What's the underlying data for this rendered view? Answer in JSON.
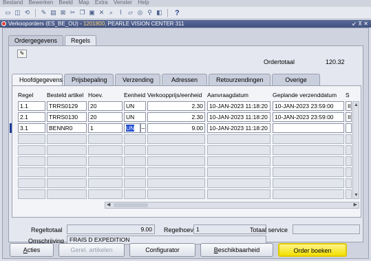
{
  "menubar": [
    "Bestand",
    "Bewerken",
    "Beeld",
    "Map",
    "Extra",
    "Venster",
    "Help"
  ],
  "toolbar": {
    "icons": [
      "folder-open-icon",
      "save-icon",
      "refresh-icon",
      "switch-icon",
      "print-icon",
      "delete-icon",
      "cut-icon",
      "copy-icon",
      "paste-icon",
      "clear-icon",
      "find-icon",
      "attach-icon",
      "folder-icon",
      "translate-icon",
      "zoom-icon",
      "window-icon"
    ],
    "help": "?"
  },
  "window": {
    "title_prefix": "Verkooporders (ES_BE_OU) - ",
    "order_number": "1201800",
    "title_suffix": ", PEARLE VISION CENTER 311",
    "controls": "↙ ⊼ ✕"
  },
  "outer_tabs": [
    "Ordergegevens",
    "Regels"
  ],
  "ordertotaal": {
    "label": "Ordertotaal",
    "value": "120.32"
  },
  "inner_tabs": [
    "Hoofdgegevens",
    "Prijsbepaling",
    "Verzending",
    "Adressen",
    "Retourzendingen",
    "Overige"
  ],
  "columns": [
    "Regel",
    "Besteld artikel",
    "Hoev.",
    "Eenheid",
    "Verkoopprijs/eenheid",
    "Aanvraagdatum",
    "Geplande verzenddatum",
    "S"
  ],
  "rows": [
    {
      "regel": "1.1",
      "artikel": "TRRS0129",
      "hoev": "20",
      "eenheid": "UN",
      "prijs": "2.30",
      "aanvraag": "10-JAN-2023 11:18:20",
      "gepland": "10-JAN-2023 23:59:00",
      "s": "II"
    },
    {
      "regel": "2.1",
      "artikel": "TRRS0130",
      "hoev": "20",
      "eenheid": "UN",
      "prijs": "2.30",
      "aanvraag": "10-JAN-2023 11:18:20",
      "gepland": "10-JAN-2023 23:59:00",
      "s": "II"
    },
    {
      "regel": "3.1",
      "artikel": "BENNR0",
      "hoev": "1",
      "eenheid": "UN",
      "prijs": "9.00",
      "aanvraag": "10-JAN-2023 11:18:20",
      "gepland": "",
      "s": ""
    }
  ],
  "footer_fields": {
    "regeltotaal_label": "Regeltotaal",
    "regeltotaal_value": "9.00",
    "regelhoev_label": "Regelhoev.",
    "regelhoev_value": "1",
    "totaal_service_label": "Totaal service",
    "totaal_service_value": "",
    "omschrijving_label": "Omschrijving",
    "omschrijving_value": "FRAIS D EXPEDITION"
  },
  "buttons": {
    "acties_u": "A",
    "acties_rest": "cties",
    "gerel": "Gerel. artikelen",
    "configurator": "Configurator",
    "beschik_u": "B",
    "beschik_rest": "eschikbaarheid",
    "order_boeken": "Order boeken"
  }
}
